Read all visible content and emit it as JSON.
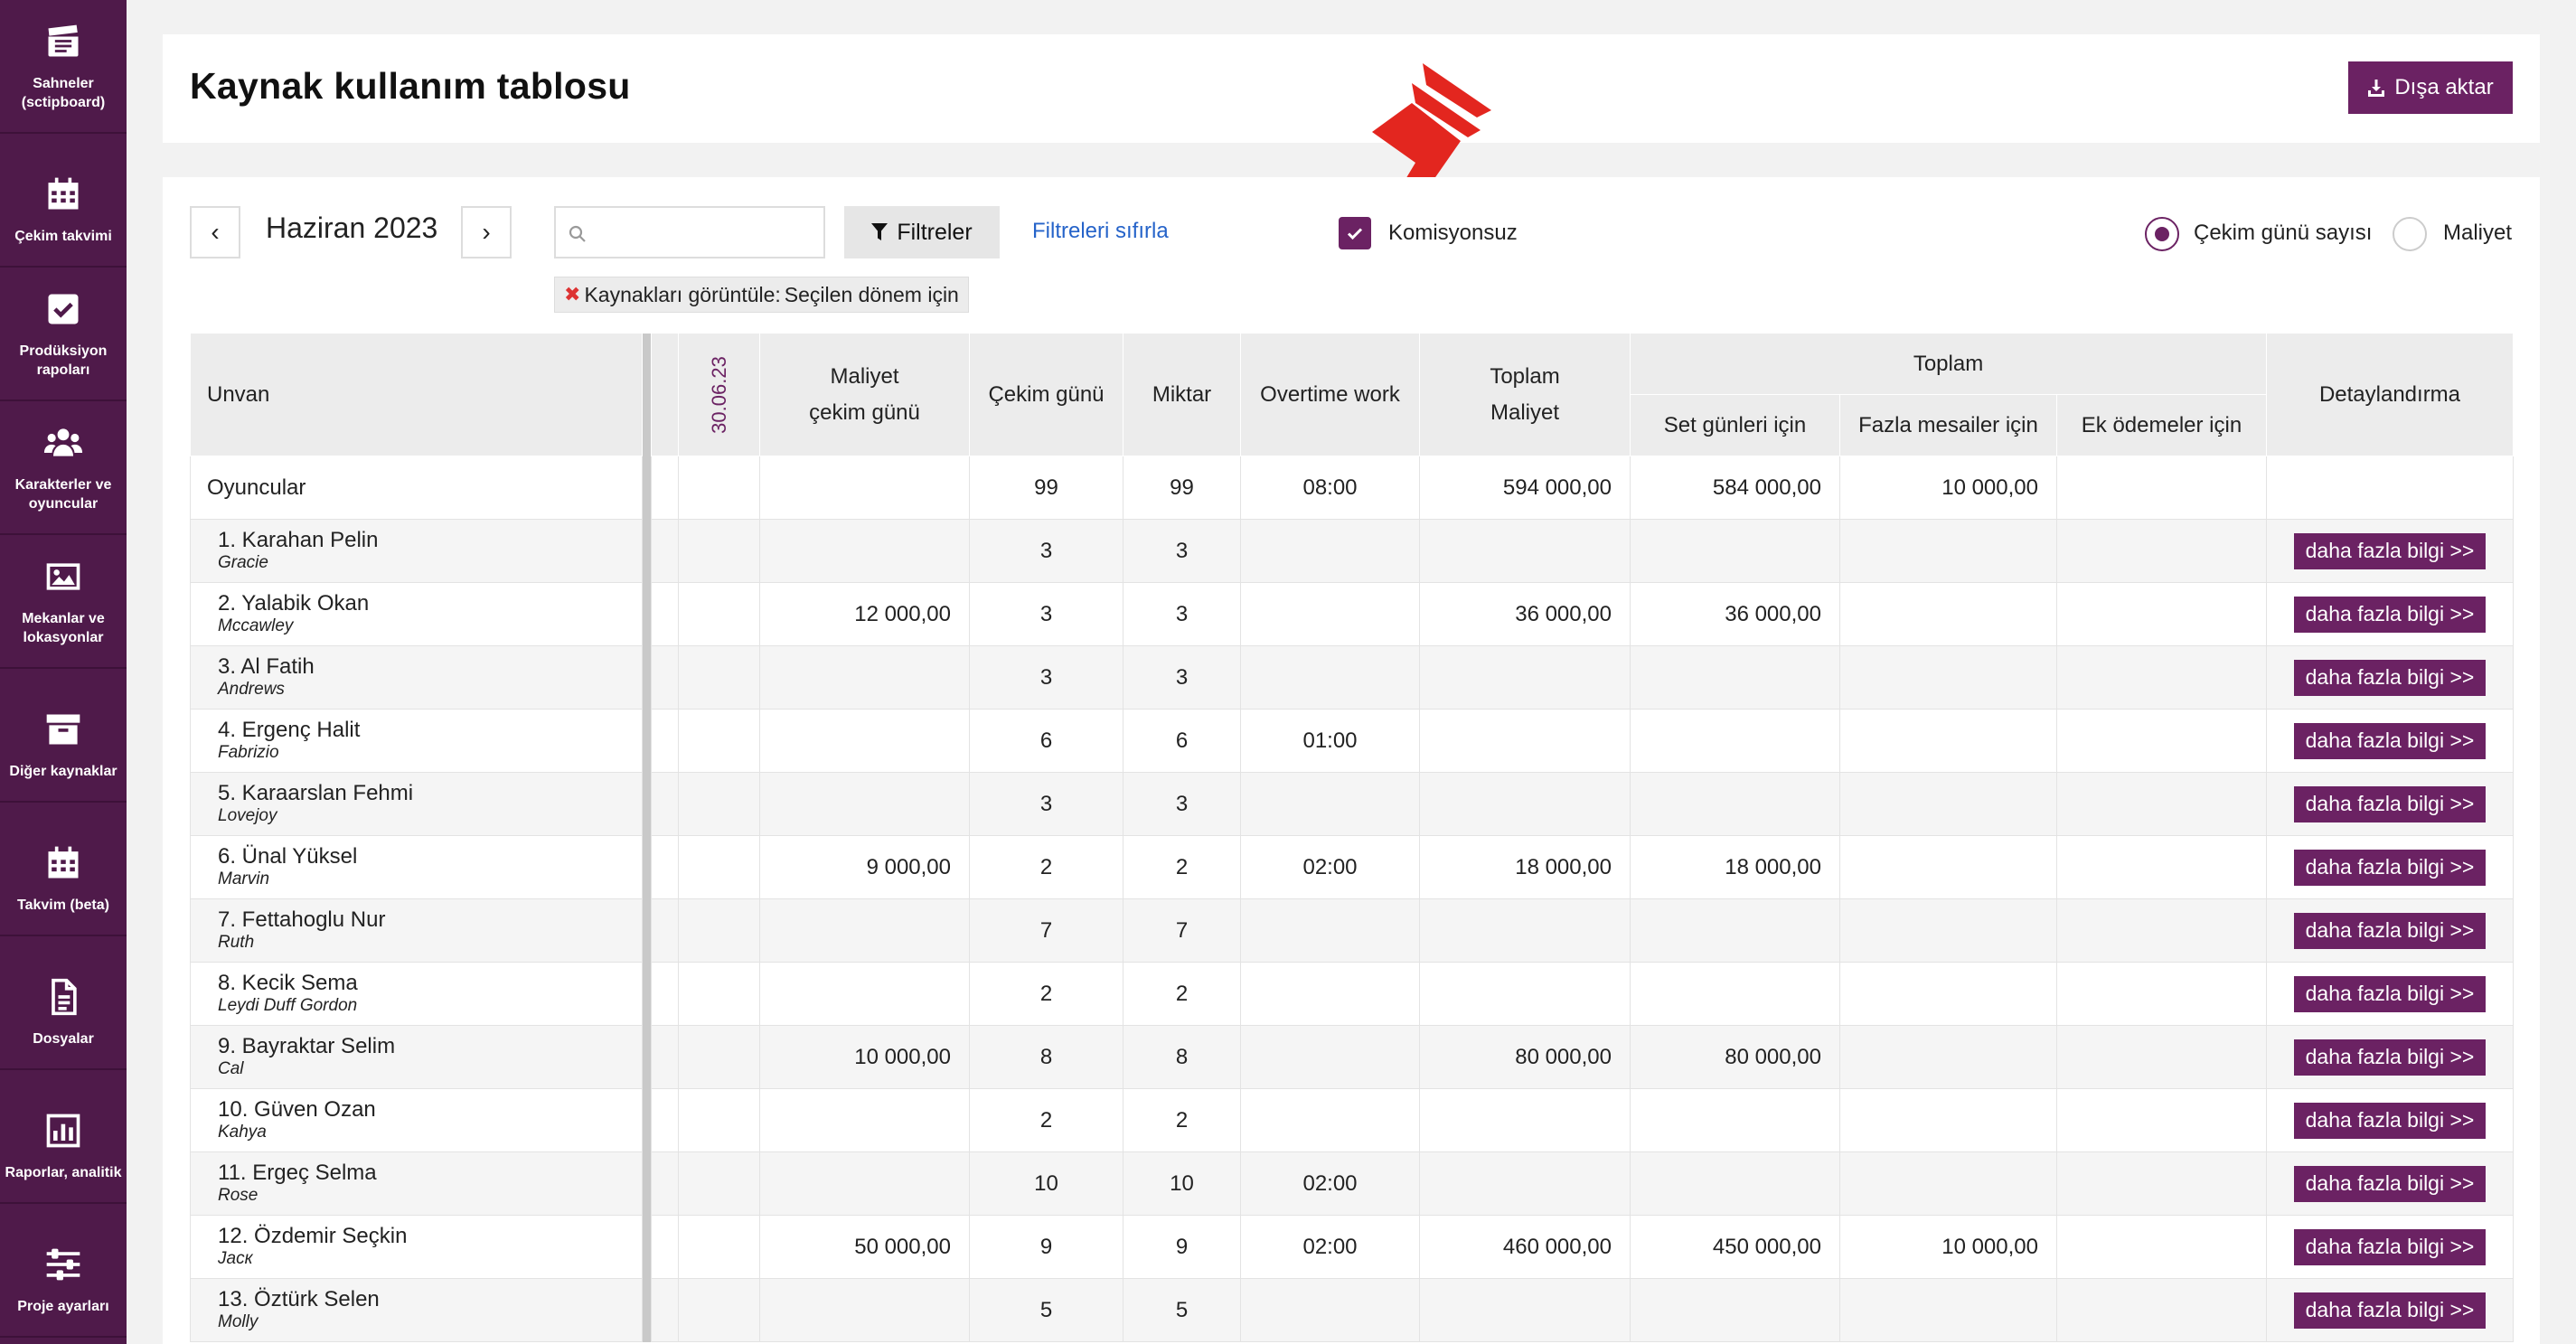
{
  "sidebar": {
    "items": [
      {
        "label": "Sahneler\n(sctipboard)",
        "icon": "clapperboard-icon"
      },
      {
        "label": "Çekim takvimi",
        "icon": "calendar-icon"
      },
      {
        "label": "Prodüksiyon\nrapoları",
        "icon": "checkbox-icon"
      },
      {
        "label": "Karakterler ve\noyuncular",
        "icon": "users-icon"
      },
      {
        "label": "Mekanlar ve\nlokasyonlar",
        "icon": "image-icon"
      },
      {
        "label": "Diğer kaynaklar",
        "icon": "archive-icon"
      },
      {
        "label": "Takvim (beta)",
        "icon": "calendar-icon"
      },
      {
        "label": "Dosyalar",
        "icon": "file-icon"
      },
      {
        "label": "Raporlar, analitik",
        "icon": "chart-icon"
      },
      {
        "label": "Proje ayarları",
        "icon": "sliders-icon"
      }
    ]
  },
  "header": {
    "title": "Kaynak kullanım tablosu",
    "export_label": "Dışa aktar"
  },
  "toolbar": {
    "prev": "‹",
    "next": "›",
    "month": "Haziran 2023",
    "search_placeholder": "",
    "filter_label": "Filtreler",
    "reset_label": "Filtreleri sıfırla",
    "chip_label": "Kaynakları görüntüle:",
    "chip_value": "Seçilen dönem için",
    "checkbox_label": "Komisyonsuz",
    "radio_days": "Çekim günü sayısı",
    "radio_cost": "Maliyet"
  },
  "colors": {
    "accent": "#6b2263",
    "sidebar": "#4f1a4a",
    "arrow": "#e3261f",
    "link": "#2563c9"
  },
  "table": {
    "headers": {
      "unvan": "Unvan",
      "date": "30.06.23",
      "cost_day_1": "Maliyet",
      "cost_day_2": "çekim günü",
      "shoot_days": "Çekim günü",
      "amount": "Miktar",
      "overtime": "Overtime work",
      "total_cost_1": "Toplam",
      "total_cost_2": "Maliyet",
      "toplam": "Toplam",
      "set_days": "Set günleri için",
      "extra_hours": "Fazla mesailer için",
      "extra_pay": "Ek ödemeler için",
      "detail": "Detaylandırma"
    },
    "group": {
      "name": "Oyuncular",
      "shoot_days": "99",
      "amount": "99",
      "overtime": "08:00",
      "total_cost": "594 000,00",
      "set_days": "584 000,00",
      "extra_hours": "10 000,00",
      "extra_pay": ""
    },
    "more_label": "daha fazla bilgi >>",
    "rows": [
      {
        "name": "1. Karahan Pelin",
        "role": "Gracie",
        "cost_day": "",
        "shoot_days": "3",
        "amount": "3",
        "overtime": "",
        "total_cost": "",
        "set_days": "",
        "extra_hours": "",
        "extra_pay": ""
      },
      {
        "name": "2. Yalabik Okan",
        "role": "Mccawley",
        "cost_day": "12 000,00",
        "shoot_days": "3",
        "amount": "3",
        "overtime": "",
        "total_cost": "36 000,00",
        "set_days": "36 000,00",
        "extra_hours": "",
        "extra_pay": ""
      },
      {
        "name": "3. Al Fatih",
        "role": "Andrews",
        "cost_day": "",
        "shoot_days": "3",
        "amount": "3",
        "overtime": "",
        "total_cost": "",
        "set_days": "",
        "extra_hours": "",
        "extra_pay": ""
      },
      {
        "name": "4. Ergenç Halit",
        "role": "Fabrizio",
        "cost_day": "",
        "shoot_days": "6",
        "amount": "6",
        "overtime": "01:00",
        "total_cost": "",
        "set_days": "",
        "extra_hours": "",
        "extra_pay": ""
      },
      {
        "name": "5. Karaarslan Fehmi",
        "role": "Lovejoy",
        "cost_day": "",
        "shoot_days": "3",
        "amount": "3",
        "overtime": "",
        "total_cost": "",
        "set_days": "",
        "extra_hours": "",
        "extra_pay": ""
      },
      {
        "name": "6. Ünal Yüksel",
        "role": "Marvin",
        "cost_day": "9 000,00",
        "shoot_days": "2",
        "amount": "2",
        "overtime": "02:00",
        "total_cost": "18 000,00",
        "set_days": "18 000,00",
        "extra_hours": "",
        "extra_pay": ""
      },
      {
        "name": "7. Fettahoglu Nur",
        "role": "Ruth",
        "cost_day": "",
        "shoot_days": "7",
        "amount": "7",
        "overtime": "",
        "total_cost": "",
        "set_days": "",
        "extra_hours": "",
        "extra_pay": ""
      },
      {
        "name": "8. Kecik Sema",
        "role": "Leydi Duff Gordon",
        "cost_day": "",
        "shoot_days": "2",
        "amount": "2",
        "overtime": "",
        "total_cost": "",
        "set_days": "",
        "extra_hours": "",
        "extra_pay": ""
      },
      {
        "name": "9. Bayraktar Selim",
        "role": "Cal",
        "cost_day": "10 000,00",
        "shoot_days": "8",
        "amount": "8",
        "overtime": "",
        "total_cost": "80 000,00",
        "set_days": "80 000,00",
        "extra_hours": "",
        "extra_pay": ""
      },
      {
        "name": "10. Güven Ozan",
        "role": "Kahya",
        "cost_day": "",
        "shoot_days": "2",
        "amount": "2",
        "overtime": "",
        "total_cost": "",
        "set_days": "",
        "extra_hours": "",
        "extra_pay": ""
      },
      {
        "name": "11. Ergeç Selma",
        "role": "Rose",
        "cost_day": "",
        "shoot_days": "10",
        "amount": "10",
        "overtime": "02:00",
        "total_cost": "",
        "set_days": "",
        "extra_hours": "",
        "extra_pay": ""
      },
      {
        "name": "12. Özdemir Seçkin",
        "role": "Jacк",
        "cost_day": "50 000,00",
        "shoot_days": "9",
        "amount": "9",
        "overtime": "02:00",
        "total_cost": "460 000,00",
        "set_days": "450 000,00",
        "extra_hours": "10 000,00",
        "extra_pay": ""
      },
      {
        "name": "13. Öztürk Selen",
        "role": "Molly",
        "cost_day": "",
        "shoot_days": "5",
        "amount": "5",
        "overtime": "",
        "total_cost": "",
        "set_days": "",
        "extra_hours": "",
        "extra_pay": ""
      }
    ]
  }
}
